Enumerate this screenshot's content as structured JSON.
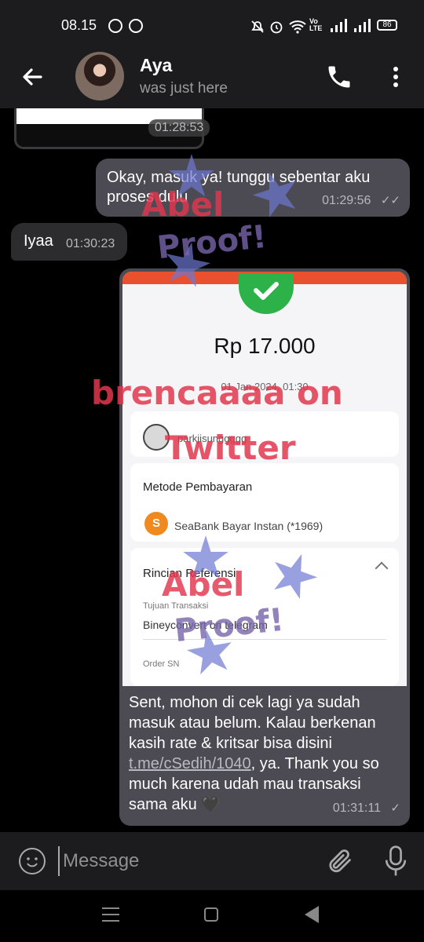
{
  "status_bar": {
    "time": "08.15",
    "battery": "86"
  },
  "header": {
    "name": "Aya",
    "status": "was just here"
  },
  "chat": {
    "previous_image_time": "01:28:53",
    "messages": [
      {
        "direction": "out",
        "text": "Okay, masuk ya! tunggu sebentar aku proses dulu",
        "time": "01:29:56"
      },
      {
        "direction": "in",
        "text": "Iyaa",
        "time": "01:30:23"
      }
    ],
    "receipt": {
      "amount": "Rp 17.000",
      "date": "01 Jan 2024, 01:30",
      "sender": "parkjisunggggg",
      "method_title": "Metode Pembayaran",
      "method": "SeaBank Bayar Instan (*1969)",
      "reference_title": "Rincian Referensi",
      "purpose_label": "Tujuan Transaksi",
      "purpose_value": "Bineyconvert on telegram",
      "order_label": "Order SN"
    },
    "caption": {
      "part1": "Sent, mohon di cek lagi ya sudah masuk atau belum. Kalau berkenan kasih rate & kritsar bisa disini ",
      "link": "t.me/cSedih/1040",
      "part2": ", ya. Thank you so much karena udah mau transaksi sama aku 🖤",
      "time": "01:31:11"
    }
  },
  "watermarks": {
    "abel": "Abel",
    "proof": "Proof!",
    "credit_line1": "brencaaaa on",
    "credit_line2": "Twitter"
  },
  "input": {
    "placeholder": "Message"
  },
  "icons": [
    "back-arrow-icon",
    "call-icon",
    "more-vert-icon",
    "emoji-icon",
    "attach-icon",
    "mic-icon",
    "read-receipt-icon"
  ]
}
